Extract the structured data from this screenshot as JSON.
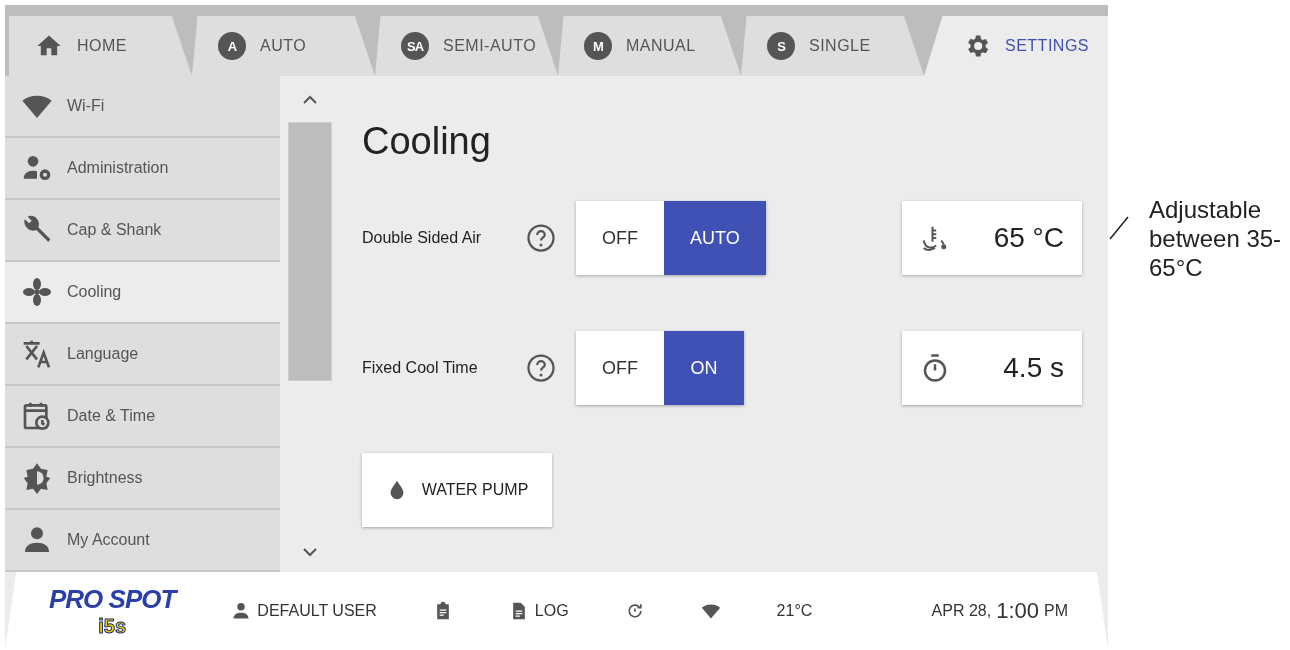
{
  "tabs": [
    {
      "kind": "home",
      "label": "HOME",
      "selected": false
    },
    {
      "kind": "badge",
      "badge": "A",
      "label": "AUTO",
      "selected": false
    },
    {
      "kind": "badge",
      "badge": "SA",
      "label": "SEMI-AUTO",
      "selected": false
    },
    {
      "kind": "badge",
      "badge": "M",
      "label": "MANUAL",
      "selected": false
    },
    {
      "kind": "badge",
      "badge": "S",
      "label": "SINGLE",
      "selected": false
    },
    {
      "kind": "gear",
      "label": "SETTINGS",
      "selected": true
    }
  ],
  "sidebar": {
    "items": [
      {
        "kind": "wifi",
        "label": "Wi-Fi",
        "selected": false
      },
      {
        "kind": "admin",
        "label": "Administration",
        "selected": false
      },
      {
        "kind": "wrench",
        "label": "Cap & Shank",
        "selected": false
      },
      {
        "kind": "fan",
        "label": "Cooling",
        "selected": true
      },
      {
        "kind": "language",
        "label": "Language",
        "selected": false
      },
      {
        "kind": "calendar",
        "label": "Date & Time",
        "selected": false
      },
      {
        "kind": "brightness",
        "label": "Brightness",
        "selected": false
      },
      {
        "kind": "person",
        "label": "My Account",
        "selected": false
      }
    ]
  },
  "content": {
    "title": "Cooling",
    "settings": [
      {
        "label": "Double Sided Air",
        "options": [
          {
            "label": "OFF",
            "selected": false
          },
          {
            "label": "AUTO",
            "selected": true
          }
        ],
        "readout": {
          "kind": "temperature",
          "value": "65 °C"
        }
      },
      {
        "label": "Fixed Cool Time",
        "options": [
          {
            "label": "OFF",
            "selected": false
          },
          {
            "label": "ON",
            "selected": true
          }
        ],
        "readout": {
          "kind": "timer",
          "value": "4.5 s"
        }
      }
    ],
    "button": "WATER PUMP"
  },
  "status_bar": {
    "logo": "PRO SPOT",
    "logo_model": "i5s",
    "user": "DEFAULT USER",
    "log": "LOG",
    "temperature": "21°C",
    "date": "APR 28,",
    "time": "1:00",
    "ampm": "PM"
  },
  "annotation": "Adjustable between 35-65°C"
}
